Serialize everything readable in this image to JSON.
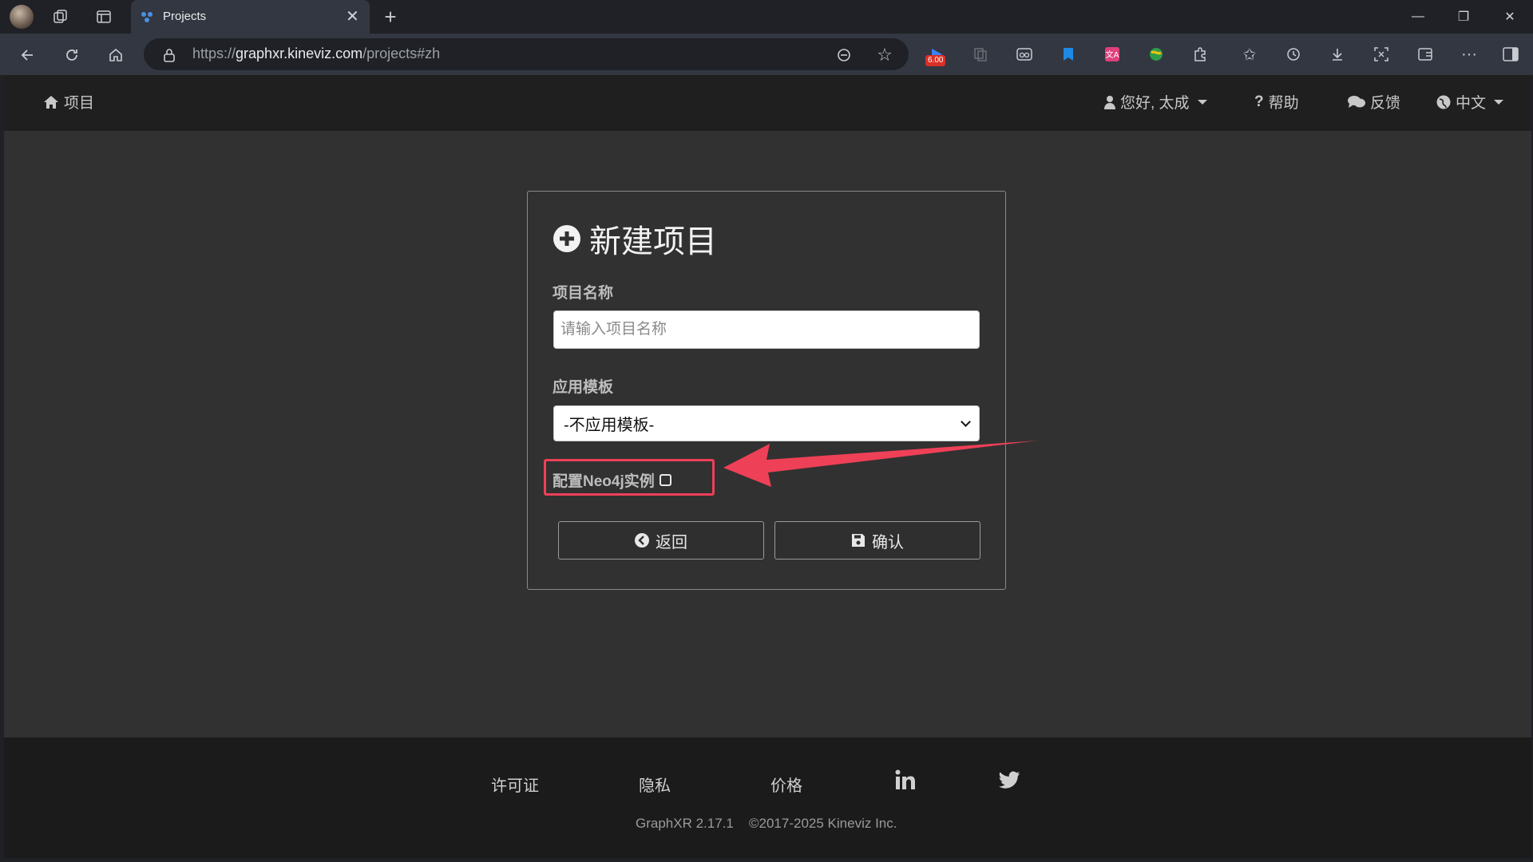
{
  "browser": {
    "tab_title": "Projects",
    "url_prefix": "https://",
    "url_host": "graphxr.kineviz.com",
    "url_path": "/projects#zh",
    "extension_badge": "6.00"
  },
  "navbar": {
    "projects_label": "项目",
    "user_label": "您好, 太成",
    "help_label": "帮助",
    "feedback_label": "反馈",
    "language_label": "中文"
  },
  "form": {
    "title": "新建项目",
    "name_label": "项目名称",
    "name_placeholder": "请输入项目名称",
    "name_value": "",
    "template_label": "应用模板",
    "template_selected": "-不应用模板-",
    "neo4j_label": "配置Neo4j实例",
    "neo4j_checked": false,
    "back_label": "返回",
    "confirm_label": "确认"
  },
  "annotation": {
    "highlight_color": "#ee4057"
  },
  "footer": {
    "license_label": "许可证",
    "privacy_label": "隐私",
    "pricing_label": "价格",
    "version": "GraphXR 2.17.1",
    "copyright": "©2017-2025 Kineviz Inc."
  },
  "colors": {
    "page_bg": "#313131",
    "navbar_bg": "#1f1f1f",
    "footer_bg": "#1b1b1b",
    "accent_red": "#ee4057"
  }
}
